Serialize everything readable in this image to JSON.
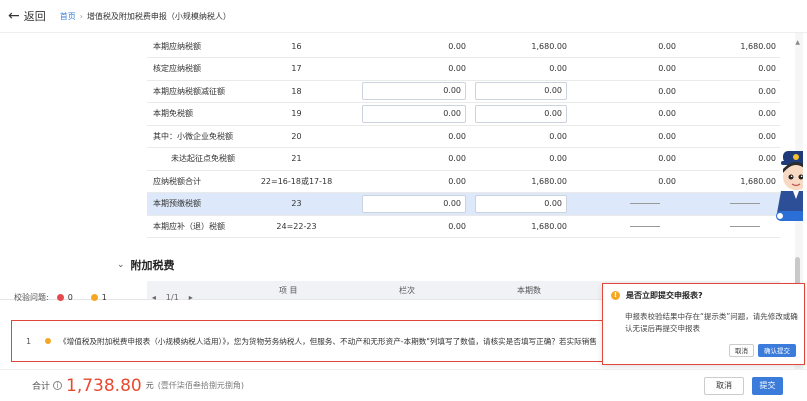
{
  "header": {
    "back_icon": "arrow-left-icon",
    "back_label": "返回",
    "breadcrumb_home": "首页",
    "breadcrumb_sep": "›",
    "breadcrumb_current": "增值税及附加税费申报（小规模纳税人）"
  },
  "table": {
    "rows": [
      {
        "name": "本期应纳税额",
        "no": "16",
        "v1": "0.00",
        "v2": "1,680.00",
        "v3": "0.00",
        "v4": "1,680.00"
      },
      {
        "name": "核定应纳税额",
        "no": "17",
        "v1": "0.00",
        "v2": "0.00",
        "v3": "0.00",
        "v4": "0.00"
      },
      {
        "name": "本期应纳税额减征额",
        "no": "18",
        "v1": "0.00",
        "v2": "0.00",
        "v3": "0.00",
        "v4": "0.00"
      },
      {
        "name": "本期免税额",
        "no": "19",
        "v1": "0.00",
        "v2": "0.00",
        "v3": "0.00",
        "v4": "0.00"
      },
      {
        "name": "其中：小微企业免税额",
        "no": "20",
        "v1": "0.00",
        "v2": "0.00",
        "v3": "0.00",
        "v4": "0.00"
      },
      {
        "name": "未达起征点免税额",
        "no": "21",
        "v1": "0.00",
        "v2": "0.00",
        "v3": "0.00",
        "v4": "0.00"
      },
      {
        "name": "应纳税额合计",
        "no": "22=16-18或17-18",
        "v1": "0.00",
        "v2": "1,680.00",
        "v3": "0.00",
        "v4": "1,680.00"
      },
      {
        "name": "本期预缴税额",
        "no": "23",
        "v1": "0.00",
        "v2": "0.00"
      },
      {
        "name": "本期应补（退）税额",
        "no": "24=22-23",
        "v1": "0.00",
        "v2": "1,680.00"
      }
    ]
  },
  "section": {
    "chevron_icon": "chevron-down-icon",
    "title": "附加税费",
    "col_item": "项 目",
    "col_no": "栏次",
    "col_current": "本期数"
  },
  "validation": {
    "label": "校验问题:",
    "error_count": "0",
    "warning_count": "1",
    "pager_prev": "◂",
    "pager_text": "1/1",
    "pager_next": "▸",
    "issue_no": "1",
    "issue_text": "《增值税及附加税费申报表（小规模纳税人适用）》，您为货物劳务纳税人，但服务、不动产和无形资产-本期数\"列填写了数值，请核实是否填写正确？若实际销售"
  },
  "popup": {
    "icon": "warning-icon",
    "title": "是否立即提交申报表?",
    "body": "申报表校验结果中存在“提示类”问题，请先修改或确认无误后再提交申报表",
    "cancel": "取消",
    "confirm": "确认提交"
  },
  "footer": {
    "total_label": "合计",
    "info_icon": "info-icon",
    "total_value": "1,738.80",
    "unit": "元",
    "total_words": "(壹仟柒佰叁拾捌元捌角)",
    "cancel": "取消",
    "submit": "提交"
  },
  "colors": {
    "accent": "#3b7cdb",
    "error": "#e5484d",
    "warning": "#f5a623",
    "highlight_border": "#e0463a",
    "total": "#e84a2f"
  }
}
